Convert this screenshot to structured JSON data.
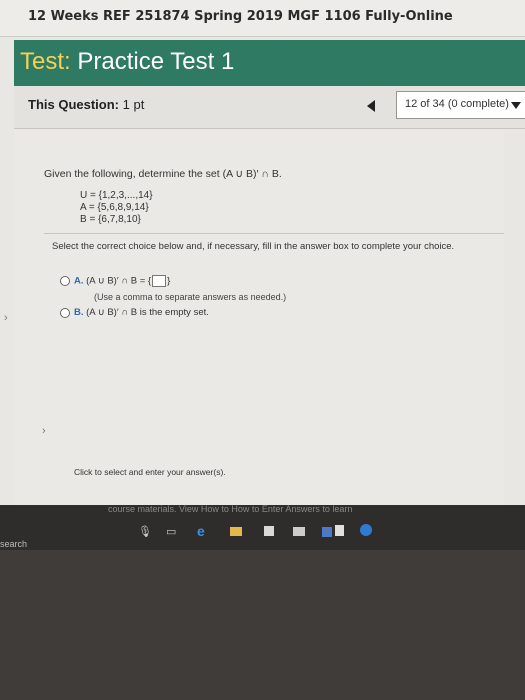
{
  "course_title": "12 Weeks REF 251874 Spring 2019 MGF 1106 Fully-Online",
  "test": {
    "prefix": "Test:",
    "name": "Practice Test 1"
  },
  "question_bar": {
    "label": "This Question:",
    "points": "1 pt",
    "progress": "12 of 34 (0 complete)"
  },
  "question": {
    "prompt": "Given the following, determine the set (A ∪ B)′ ∩ B.",
    "sets": [
      "U = {1,2,3,...,14}",
      "A = {5,6,8,9,14}",
      "B = {6,7,8,10}"
    ],
    "instruction": "Select the correct choice below and, if necessary, fill in the answer box to complete your choice.",
    "choices": [
      {
        "letter": "A.",
        "text_pre": "(A ∪ B)′ ∩ B = {",
        "text_post": "}",
        "hint": "(Use a comma to separate answers as needed.)"
      },
      {
        "letter": "B.",
        "text": "(A ∪ B)′ ∩ B is the empty set."
      }
    ],
    "click_message": "Click to select and enter your answer(s)."
  },
  "footer": {
    "course_materials": "course materials. View How to How to Enter Answers to learn"
  },
  "taskbar": {
    "search": "search"
  }
}
